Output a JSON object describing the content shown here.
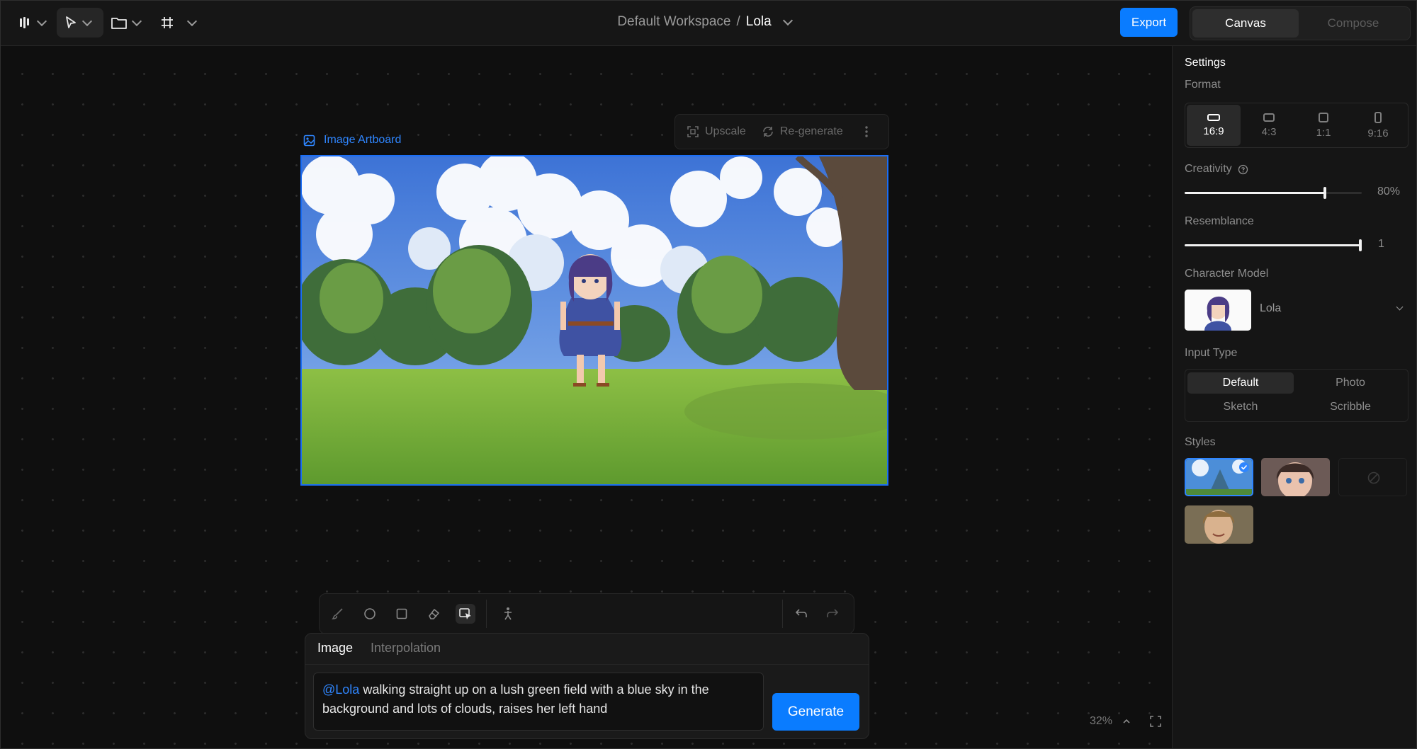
{
  "header": {
    "workspace": "Default Workspace",
    "separator": "/",
    "project": "Lola",
    "export_label": "Export",
    "modes": [
      "Canvas",
      "Compose"
    ]
  },
  "canvas": {
    "artboard_label": "Image Artboard",
    "upscale_label": "Upscale",
    "regenerate_label": "Re-generate",
    "zoom": "32%"
  },
  "prompt": {
    "tabs": [
      "Image",
      "Interpolation"
    ],
    "mention": "@Lola",
    "text": " walking straight up on a lush green field with a blue sky in the background and lots of clouds, raises her left hand",
    "generate_label": "Generate"
  },
  "settings": {
    "title": "Settings",
    "format_label": "Format",
    "formats": [
      "16:9",
      "4:3",
      "1:1",
      "9:16"
    ],
    "selected_format": "16:9",
    "creativity_label": "Creativity",
    "creativity_value": "80%",
    "creativity_fraction": 0.8,
    "resemblance_label": "Resemblance",
    "resemblance_value": "1",
    "resemblance_fraction": 1.0,
    "character_model_label": "Character Model",
    "character_model_value": "Lola",
    "input_type_label": "Input Type",
    "input_types": [
      "Default",
      "Photo",
      "Sketch",
      "Scribble"
    ],
    "selected_input_type": "Default",
    "styles_label": "Styles"
  },
  "colors": {
    "accent": "#0a7cff",
    "background": "#0e0e0e",
    "panel": "#151515"
  }
}
